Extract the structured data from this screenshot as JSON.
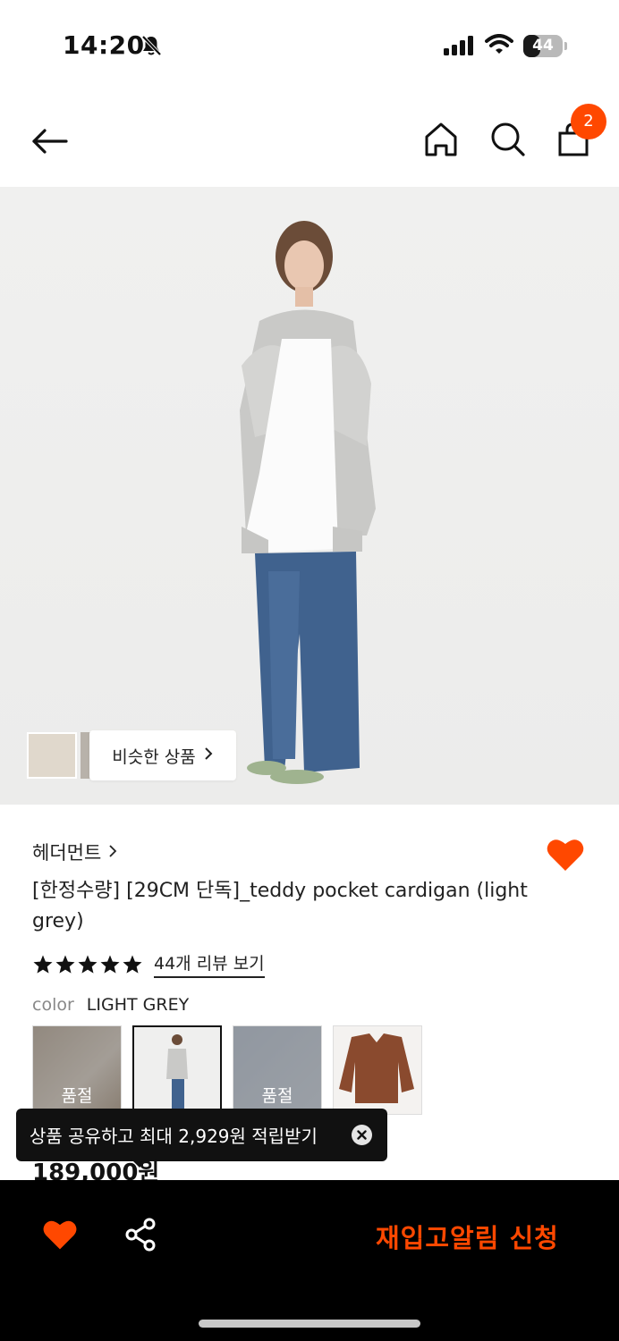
{
  "status_bar": {
    "time": "14:20",
    "battery_level": "44",
    "icons": [
      "bell-slash-icon",
      "signal-icon",
      "wifi-icon",
      "battery-icon"
    ]
  },
  "header": {
    "cart_count": "2",
    "icons": [
      "arrow-left-icon",
      "home-icon",
      "search-icon",
      "bag-icon"
    ]
  },
  "hero": {
    "similar_label": "비슷한 상품"
  },
  "product": {
    "brand": "헤더먼트",
    "title": "[한정수량] [29CM 단독]_teddy pocket cardigan (light grey)",
    "rating_stars": 5,
    "review_link": "44개 리뷰 보기",
    "color_label": "color",
    "color_value": "LIGHT GREY",
    "swatches": [
      {
        "sold_out_label": "품절"
      },
      {
        "sold_out_label": ""
      },
      {
        "sold_out_label": "품절"
      },
      {
        "sold_out_label": ""
      }
    ],
    "price": "189,000원"
  },
  "tooltip": {
    "text": "상품 공유하고 최대 2,929원 적립받기"
  },
  "bottom_bar": {
    "cta_label": "재입고알림 신청"
  },
  "colors": {
    "accent": "#ff4800",
    "bottom_bar_bg": "#000000"
  }
}
